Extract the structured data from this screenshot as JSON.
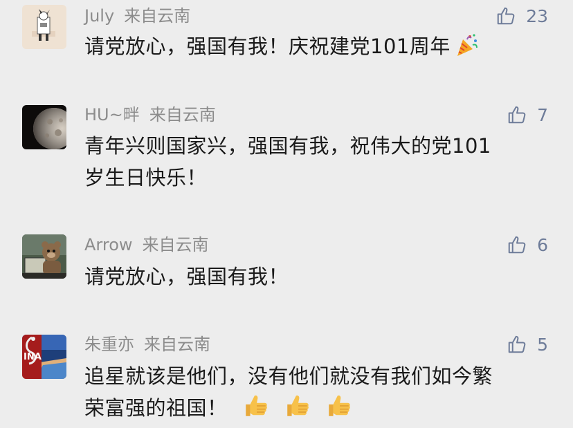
{
  "comments": [
    {
      "username": "July",
      "location": "来自云南",
      "likes": "23",
      "text": "请党放心，强国有我！庆祝建党101周年",
      "emoji": "party-popper-emoji"
    },
    {
      "username": "HU~畔",
      "location": "来自云南",
      "likes": "7",
      "text_line1": "青年兴则国家兴，强国有我，祝伟大的党101",
      "text_line2": "岁生日快乐！"
    },
    {
      "username": "Arrow",
      "location": "来自云南",
      "likes": "6",
      "text": "请党放心，强国有我！"
    },
    {
      "username": "朱重亦",
      "location": "来自云南",
      "likes": "5",
      "text_line1": "追星就该是他们，没有他们就没有我们如今繁",
      "text_line2": "荣富强的祖国！",
      "emoji": "thumbs-up-emoji x3",
      "avatar_badge": "INA"
    }
  ],
  "colors": {
    "background": "#ededed",
    "meta_text": "#8c8c8c",
    "like_icon": "#6e7c99",
    "body_text": "#1a1a1a"
  }
}
